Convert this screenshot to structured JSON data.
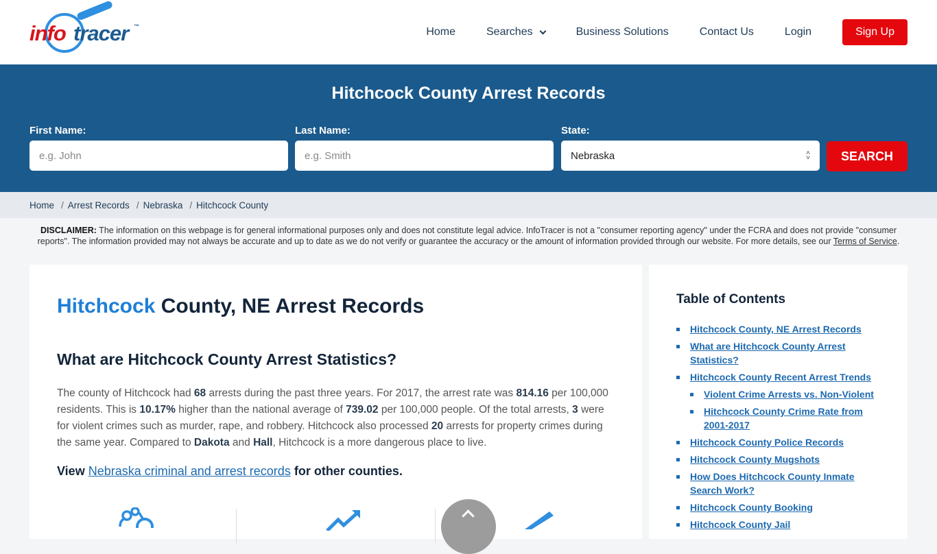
{
  "header": {
    "logo": {
      "part1": "info",
      "part2": "tracer",
      "tm": "™"
    },
    "nav": [
      {
        "label": "Home"
      },
      {
        "label": "Searches",
        "has_dropdown": true
      },
      {
        "label": "Business Solutions"
      },
      {
        "label": "Contact Us"
      },
      {
        "label": "Login"
      }
    ],
    "signup_label": "Sign Up"
  },
  "search": {
    "title": "Hitchcock County Arrest Records",
    "first_name": {
      "label": "First Name:",
      "placeholder": "e.g. John",
      "value": ""
    },
    "last_name": {
      "label": "Last Name:",
      "placeholder": "e.g. Smith",
      "value": ""
    },
    "state": {
      "label": "State:",
      "value": "Nebraska"
    },
    "button_label": "SEARCH"
  },
  "breadcrumb": [
    "Home",
    "Arrest Records",
    "Nebraska",
    "Hitchcock County"
  ],
  "disclaimer": {
    "label": "DISCLAIMER:",
    "text": " The information on this webpage is for general informational purposes only and does not constitute legal advice. InfoTracer is not a \"consumer reporting agency\" under the FCRA and does not provide \"consumer reports\". The information provided may not always be accurate and up to date as we do not verify or guarantee the accuracy or the amount of information provided through our website. For more details, see our ",
    "link": "Terms of Service",
    "end": "."
  },
  "main": {
    "title_highlight": "Hitchcock",
    "title_rest": " County, NE Arrest Records",
    "stats_heading": "What are Hitchcock County Arrest Statistics?",
    "paragraph": {
      "t1": "The county of Hitchcock had ",
      "arrests": "68",
      "t2": " arrests during the past three years. For 2017, the arrest rate was ",
      "rate": "814.16",
      "t3": " per 100,000 residents. This is ",
      "pct": "10.17%",
      "t4": " higher than the national average of ",
      "national": "739.02",
      "t5": " per 100,000 people. Of the total arrests, ",
      "violent": "3",
      "t6": " were for violent crimes such as murder, rape, and robbery. Hitchcock also processed ",
      "property": "20",
      "t7": " arrests for property crimes during the same year. Compared to ",
      "c1": "Dakota",
      "t8": " and ",
      "c2": "Hall",
      "t9": ", Hitchcock is a more dangerous place to live."
    },
    "view_line": {
      "prefix": "View ",
      "link": "Nebraska criminal and arrest records",
      "suffix": " for other counties."
    },
    "stat_icons": [
      "handcuffs-icon",
      "trend-up-icon",
      "gun-icon"
    ]
  },
  "toc": {
    "title": "Table of Contents",
    "items": [
      {
        "label": "Hitchcock County, NE Arrest Records",
        "level": 1
      },
      {
        "label": "What are Hitchcock County Arrest Statistics?",
        "level": 1
      },
      {
        "label": "Hitchcock County Recent Arrest Trends",
        "level": 1
      },
      {
        "label": "Violent Crime Arrests vs. Non-Violent",
        "level": 2
      },
      {
        "label": "Hitchcock County Crime Rate from 2001-2017",
        "level": 2
      },
      {
        "label": "Hitchcock County Police Records",
        "level": 1
      },
      {
        "label": "Hitchcock County Mugshots",
        "level": 1
      },
      {
        "label": "How Does Hitchcock County Inmate Search Work?",
        "level": 1
      },
      {
        "label": "Hitchcock County Booking",
        "level": 1
      },
      {
        "label": "Hitchcock County Jail",
        "level": 1
      }
    ]
  },
  "colors": {
    "brand_blue": "#1b5a8c",
    "accent_red": "#e4080e",
    "link_blue": "#1e6ab0",
    "highlight_blue": "#1e7fd6"
  }
}
